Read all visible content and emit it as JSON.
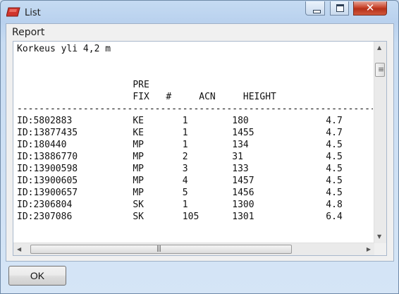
{
  "window": {
    "title": "List",
    "icon": "red-flag-icon"
  },
  "titlebar_buttons": {
    "minimize": "minimize-icon",
    "maximize": "maximize-icon",
    "close": "close-icon",
    "close_glyph": "✕"
  },
  "group": {
    "label": "Report"
  },
  "report": {
    "heading": "Korkeus yli 4,2 m",
    "header_line1": "PRE",
    "header_line2": "FIX   #     ACN     HEIGHT",
    "rows": [
      {
        "id": "ID:5802883",
        "prefix": "KE",
        "num": "1",
        "acn": "180",
        "height": "4.7"
      },
      {
        "id": "ID:13877435",
        "prefix": "KE",
        "num": "1",
        "acn": "1455",
        "height": "4.7"
      },
      {
        "id": "ID:180440",
        "prefix": "MP",
        "num": "1",
        "acn": "134",
        "height": "4.5"
      },
      {
        "id": "ID:13886770",
        "prefix": "MP",
        "num": "2",
        "acn": "31",
        "height": "4.5"
      },
      {
        "id": "ID:13900598",
        "prefix": "MP",
        "num": "3",
        "acn": "133",
        "height": "4.5"
      },
      {
        "id": "ID:13900605",
        "prefix": "MP",
        "num": "4",
        "acn": "1457",
        "height": "4.5"
      },
      {
        "id": "ID:13900657",
        "prefix": "MP",
        "num": "5",
        "acn": "1456",
        "height": "4.5"
      },
      {
        "id": "ID:2306804",
        "prefix": "SK",
        "num": "1",
        "acn": "1300",
        "height": "4.8"
      },
      {
        "id": "ID:2307086",
        "prefix": "SK",
        "num": "105",
        "acn": "1301",
        "height": "6.4"
      }
    ]
  },
  "buttons": {
    "ok": "OK"
  },
  "scroll_glyphs": {
    "up": "▲",
    "down": "▼",
    "left": "◀",
    "right": "▶",
    "grip_v": "≡",
    "grip_h": "|||"
  }
}
